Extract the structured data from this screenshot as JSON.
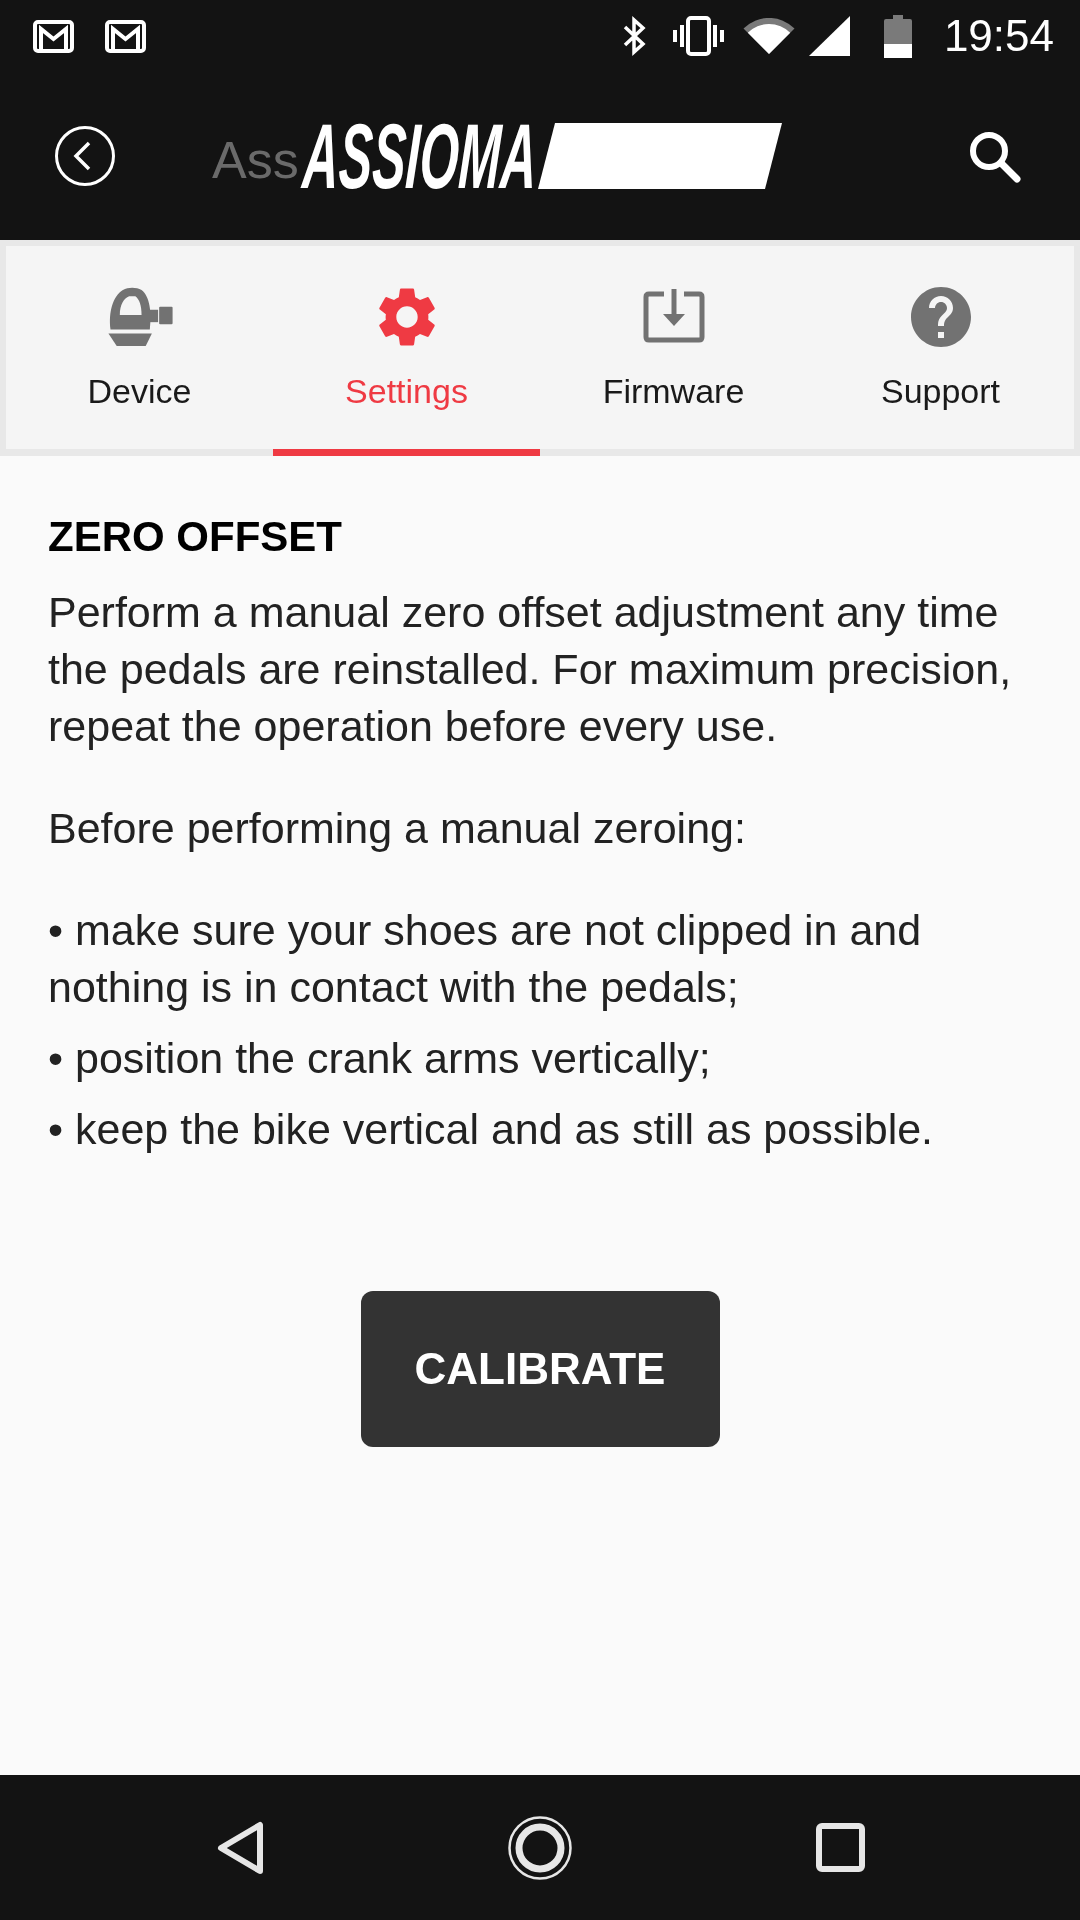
{
  "status_bar": {
    "time": "19:54"
  },
  "app_bar": {
    "title": "Ass",
    "logo": "ASSIOMA"
  },
  "tabs": [
    {
      "kind": "device",
      "label": "Device",
      "selected": false
    },
    {
      "kind": "settings",
      "label": "Settings",
      "selected": true
    },
    {
      "kind": "firmware",
      "label": "Firmware",
      "selected": false
    },
    {
      "kind": "support",
      "label": "Support",
      "selected": false
    }
  ],
  "zero_offset": {
    "heading": "ZERO OFFSET",
    "paragraphs": [
      "Perform a manual zero offset adjustment any time the pedals are reinstalled. For maximum precision, repeat the operation before every use.",
      "Before performing a manual zeroing:"
    ],
    "bullets": [
      "• make sure your shoes are not clipped in and nothing is in contact with the pedals;",
      "• position the crank arms vertically;",
      "• keep the bike vertical and as still as possible."
    ],
    "button": {
      "label": "CALIBRATE"
    }
  }
}
